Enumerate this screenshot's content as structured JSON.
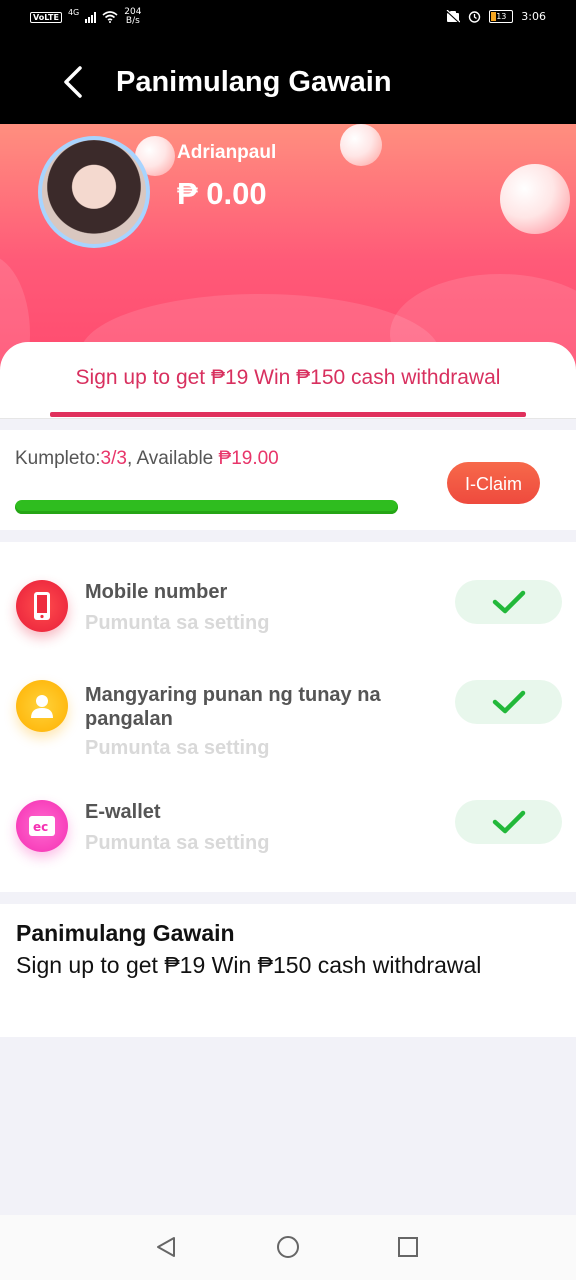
{
  "status_bar": {
    "volte": "VoLTE",
    "network": "4G",
    "speed_value": "204",
    "speed_unit": "B/s",
    "battery": "13",
    "time": "3:06"
  },
  "header": {
    "title": "Panimulang Gawain"
  },
  "profile": {
    "username": "Adrianpaul",
    "balance": "₱ 0.00"
  },
  "tab": {
    "label": "Sign up to get ₱19 Win ₱150 cash withdrawal"
  },
  "progress": {
    "prefix": "Kumpleto:",
    "completed": "3/3",
    "middle": ", Available ",
    "available": "₱19.00",
    "fraction": 1.0,
    "claim_label": "I-Claim"
  },
  "tasks": [
    {
      "title": "Mobile number",
      "subtitle": "Pumunta sa setting",
      "icon": "phone-icon",
      "color": "#ee2d3f"
    },
    {
      "title": "Mangyaring punan ng tunay na pangalan",
      "subtitle": "Pumunta sa setting",
      "icon": "user-icon",
      "color": "#ffbe0b"
    },
    {
      "title": "E-wallet",
      "subtitle": "Pumunta sa setting",
      "icon": "wallet-icon",
      "color": "#ff3fbf"
    }
  ],
  "info": {
    "title": "Panimulang Gawain",
    "description": "Sign up to get ₱19 Win ₱150 cash withdrawal"
  },
  "colors": {
    "accent": "#e0305c",
    "progress_green": "#2fbd1f",
    "claim": "#f05a40",
    "check_green": "#22b83a"
  }
}
